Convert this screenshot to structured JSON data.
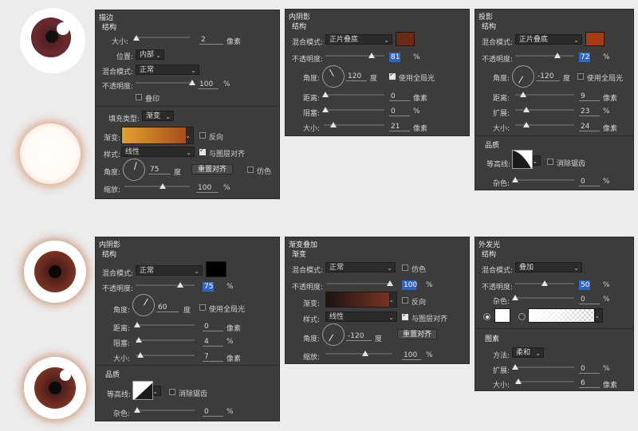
{
  "stroke": {
    "title": "描边",
    "structure": "结构",
    "size_label": "大小:",
    "size_value": "2",
    "size_unit": "像素",
    "position_label": "位置:",
    "position_value": "内部",
    "blend_label": "混合模式:",
    "blend_value": "正常",
    "opacity_label": "不透明度:",
    "opacity_value": "100",
    "opacity_unit": "%",
    "emboss_label": "叠印",
    "fill_type_label": "填充类型:",
    "fill_type_value": "渐变",
    "gradient_label": "渐变:",
    "reverse_label": "反向",
    "style_label": "样式:",
    "style_value": "线性",
    "align_label": "与图层对齐",
    "angle_label": "角度:",
    "angle_value": "75",
    "angle_unit": "度",
    "reset_align": "重置对齐",
    "dither_label": "仿色",
    "scale_label": "缩放:",
    "scale_value": "100",
    "scale_unit": "%",
    "colors": {
      "grad_start": "#e1a12a",
      "grad_end": "#a84d1c"
    }
  },
  "inner_shadow_top": {
    "title": "内阴影",
    "structure": "结构",
    "blend_label": "混合模式:",
    "blend_value": "正片叠底",
    "color": "#6b2a12",
    "opacity_label": "不透明度:",
    "opacity_value": "81",
    "opacity_unit": "%",
    "angle_label": "角度:",
    "angle_value": "120",
    "angle_unit": "度",
    "global_light": "使用全局光",
    "distance_label": "距离:",
    "distance_value": "0",
    "distance_unit": "像素",
    "choke_label": "阻塞:",
    "choke_value": "0",
    "choke_unit": "%",
    "size_label": "大小:",
    "size_value": "21",
    "size_unit": "像素"
  },
  "drop_shadow": {
    "title": "投影",
    "structure": "结构",
    "blend_label": "混合模式:",
    "blend_value": "正片叠底",
    "color": "#a83a10",
    "opacity_label": "不透明度:",
    "opacity_value": "72",
    "opacity_unit": "%",
    "angle_label": "角度:",
    "angle_value": "-120",
    "angle_unit": "度",
    "global_light": "使用全局光",
    "distance_label": "距离:",
    "distance_value": "9",
    "distance_unit": "像素",
    "spread_label": "扩展:",
    "spread_value": "23",
    "spread_unit": "%",
    "size_label": "大小:",
    "size_value": "24",
    "size_unit": "像素",
    "quality": "品质",
    "contour_label": "等高线:",
    "antialias": "消除锯齿",
    "noise_label": "杂色:",
    "noise_value": "0",
    "noise_unit": "%"
  },
  "inner_shadow_bottom": {
    "title": "内阴影",
    "structure": "结构",
    "blend_label": "混合模式:",
    "blend_value": "正常",
    "color": "#000000",
    "opacity_label": "不透明度:",
    "opacity_value": "75",
    "opacity_unit": "%",
    "angle_label": "角度:",
    "angle_value": "60",
    "angle_unit": "度",
    "global_light": "使用全局光",
    "distance_label": "距离:",
    "distance_value": "0",
    "distance_unit": "像素",
    "choke_label": "阻塞:",
    "choke_value": "4",
    "choke_unit": "%",
    "size_label": "大小:",
    "size_value": "7",
    "size_unit": "像素",
    "quality": "品质",
    "contour_label": "等高线:",
    "antialias": "消除锯齿",
    "noise_label": "杂色:",
    "noise_value": "0",
    "noise_unit": "%"
  },
  "gradient_overlay": {
    "title": "渐变叠加",
    "sub": "渐变",
    "blend_label": "混合模式:",
    "blend_value": "正常",
    "dither_label": "仿色",
    "opacity_label": "不透明度:",
    "opacity_value": "100",
    "opacity_unit": "%",
    "gradient_label": "渐变:",
    "reverse_label": "反向",
    "style_label": "样式:",
    "style_value": "线性",
    "align_label": "与图层对齐",
    "reset_align": "重置对齐",
    "angle_label": "角度:",
    "angle_value": "-120",
    "angle_unit": "度",
    "scale_label": "缩放:",
    "scale_value": "100",
    "scale_unit": "%",
    "colors": {
      "grad_start": "#1c1414",
      "grad_end": "#7a3320"
    }
  },
  "outer_glow": {
    "title": "外发光",
    "structure": "结构",
    "blend_label": "混合模式:",
    "blend_value": "叠加",
    "opacity_label": "不透明度:",
    "opacity_value": "50",
    "opacity_unit": "%",
    "noise_label": "杂色:",
    "noise_value": "0",
    "noise_unit": "%",
    "elements": "图素",
    "technique_label": "方法:",
    "technique_value": "柔和",
    "spread_label": "扩展:",
    "spread_value": "0",
    "spread_unit": "%",
    "size_label": "大小:",
    "size_value": "6",
    "size_unit": "像素"
  },
  "colors": {
    "panel_bg": "#3c3c3c",
    "page_bg": "#ececec",
    "selection": "#2f66c4"
  },
  "icons": [
    "chevron-down-icon",
    "checkbox-icon",
    "angle-dial-icon",
    "contour-icon",
    "radio-icon"
  ]
}
